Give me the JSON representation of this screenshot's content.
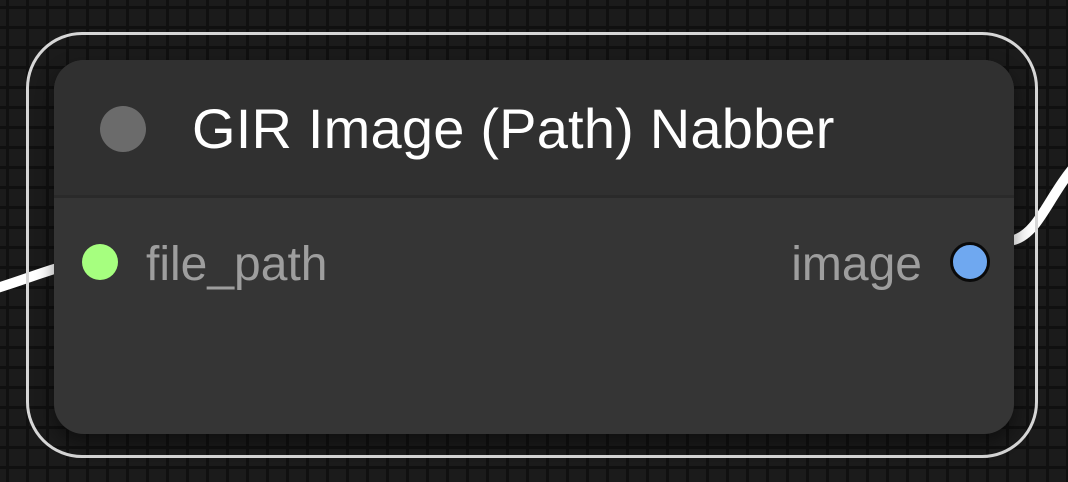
{
  "node": {
    "title": "GIR Image (Path) Nabber",
    "inputs": [
      {
        "name": "file_path",
        "color": "#a6ff7f"
      }
    ],
    "outputs": [
      {
        "name": "image",
        "color": "#6fa8f0"
      }
    ]
  },
  "canvas": {
    "background": "#1b1b1b",
    "grid_color": "#101010",
    "wire_color": "#ffffff",
    "selection_color": "#d7d7d7"
  }
}
